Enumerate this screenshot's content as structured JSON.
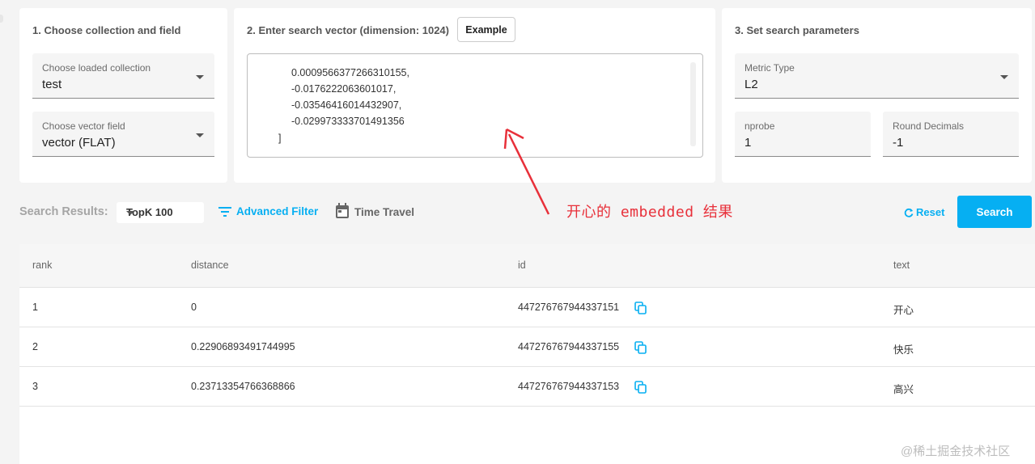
{
  "step1": {
    "title": "1. Choose collection and field",
    "collection": {
      "label": "Choose loaded collection",
      "value": "test"
    },
    "vector_field": {
      "label": "Choose vector field",
      "value": "vector (FLAT)"
    }
  },
  "step2": {
    "title": "2. Enter search vector (dimension: 1024)",
    "example_label": "Example",
    "vector_lines": [
      "0.0009566377266310155,",
      "-0.0176222063601017,",
      "-0.03546416014432907,",
      "-0.029973333701491356",
      "]"
    ]
  },
  "step3": {
    "title": "3. Set search parameters",
    "metric": {
      "label": "Metric Type",
      "value": "L2"
    },
    "nprobe": {
      "label": "nprobe",
      "value": "1"
    },
    "round": {
      "label": "Round Decimals",
      "value": "-1"
    }
  },
  "toolbar": {
    "results_label": "Search Results:",
    "topk": "TopK 100",
    "advanced_filter": "Advanced Filter",
    "time_travel": "Time Travel",
    "reset": "Reset",
    "search": "Search"
  },
  "annotation": "开心的 embedded 结果",
  "table": {
    "headers": [
      "rank",
      "distance",
      "id",
      "text"
    ],
    "rows": [
      {
        "rank": "1",
        "distance": "0",
        "id": "447276767944337151",
        "text": "开心"
      },
      {
        "rank": "2",
        "distance": "0.22906893491744995",
        "id": "447276767944337155",
        "text": "快乐"
      },
      {
        "rank": "3",
        "distance": "0.23713354766368866",
        "id": "447276767944337153",
        "text": "高兴"
      }
    ]
  },
  "watermark": "@稀土掘金技术社区",
  "colors": {
    "accent": "#06aff2",
    "annotation": "#e8303a"
  }
}
